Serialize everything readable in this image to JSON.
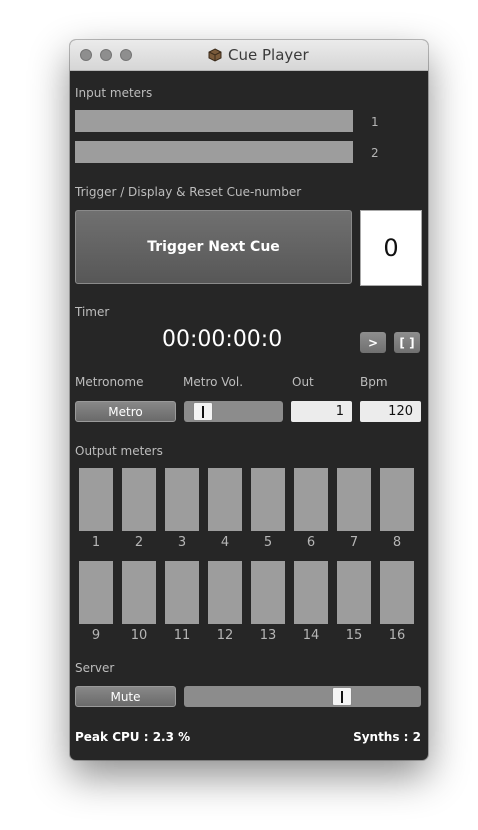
{
  "window": {
    "title": "Cue Player"
  },
  "input_meters": {
    "label": "Input meters",
    "channels": [
      "1",
      "2"
    ]
  },
  "trigger": {
    "section_label": "Trigger / Display & Reset Cue-number",
    "button_label": "Trigger Next Cue",
    "cue_number": "0"
  },
  "timer": {
    "label": "Timer",
    "value": "00:00:00:0",
    "play_label": ">",
    "reset_label": "[ ]"
  },
  "metronome": {
    "metronome_label": "Metronome",
    "volume_label": "Metro Vol.",
    "out_label": "Out",
    "bpm_label": "Bpm",
    "button_label": "Metro",
    "volume_level": 0.12,
    "out_value": "1",
    "bpm_value": "120"
  },
  "output_meters": {
    "label": "Output meters",
    "row1": [
      "1",
      "2",
      "3",
      "4",
      "5",
      "6",
      "7",
      "8"
    ],
    "row2": [
      "9",
      "10",
      "11",
      "12",
      "13",
      "14",
      "15",
      "16"
    ]
  },
  "server": {
    "label": "Server",
    "mute_label": "Mute",
    "volume_level": 0.68
  },
  "footer": {
    "peak_cpu": "Peak CPU : 2.3 %",
    "synths": "Synths : 2"
  },
  "colors": {
    "window_bg": "#262626",
    "meter": "#9d9d9d",
    "text": "#bdbdbd"
  }
}
